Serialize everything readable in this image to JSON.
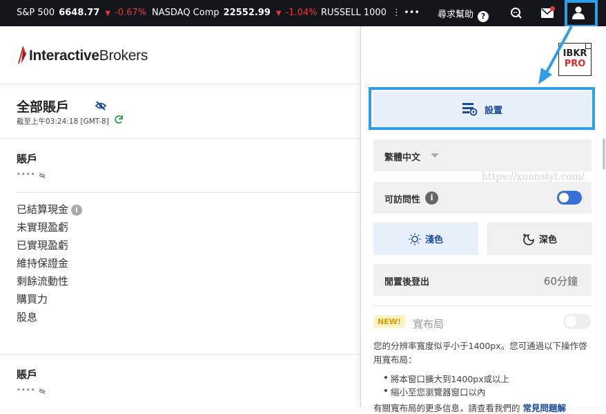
{
  "ticker": {
    "items": [
      {
        "name": "S&P 500",
        "value": "6648.77",
        "change": "-0.67%"
      },
      {
        "name": "NASDAQ Comp",
        "value": "22552.99",
        "change": "-1.04%"
      },
      {
        "name": "RUSSELL 1000",
        "more": "⋮  •••"
      }
    ],
    "help_label": "尋求幫助",
    "help_glyph": "?",
    "icons": [
      "chat-icon",
      "mail-icon",
      "user-icon"
    ]
  },
  "brand": {
    "logo_bold": "Interactive",
    "logo_rest": "Brokers"
  },
  "account": {
    "title": "全部賬戶",
    "as_of": "截至上午03:24:18 [GMT-8]",
    "sections": [
      {
        "label": "賬戶",
        "masked": "••••"
      },
      {
        "label": "賬戶",
        "masked": "••••"
      }
    ],
    "metrics": [
      "已結算現金",
      "未實現盈虧",
      "已實現盈虧",
      "維持保證金",
      "剩餘流動性",
      "購買力",
      "股息"
    ]
  },
  "panel": {
    "badge_line1": "IBKR",
    "badge_line2": "PRO",
    "settings_label": "設置",
    "language": "繁體中文",
    "accessibility_label": "可訪問性",
    "accessibility_info": "i",
    "theme_light": "淺色",
    "theme_dark": "深色",
    "logout_label": "閒置後登出",
    "logout_value": "60分鐘",
    "new_badge": "NEW!",
    "wide_layout_label": "寬布局",
    "wide_desc": "您的分辨率寬度似乎小于1400px。您可通過以下操作啓用寬布局：",
    "bullets": [
      "將本窗口擴大到1400px或以上",
      "縮小至您瀏覽器窗口以內"
    ],
    "more_text": "有關寬布局的更多信息，請查看我們的",
    "more_link": "常見問題解"
  },
  "watermark": "https://xuanstyl.com/",
  "colors": {
    "accent_blue": "#2e9ee6",
    "negative": "#e8373d",
    "brand_red": "#d62b2b",
    "toggle_on": "#3a6fd6"
  }
}
